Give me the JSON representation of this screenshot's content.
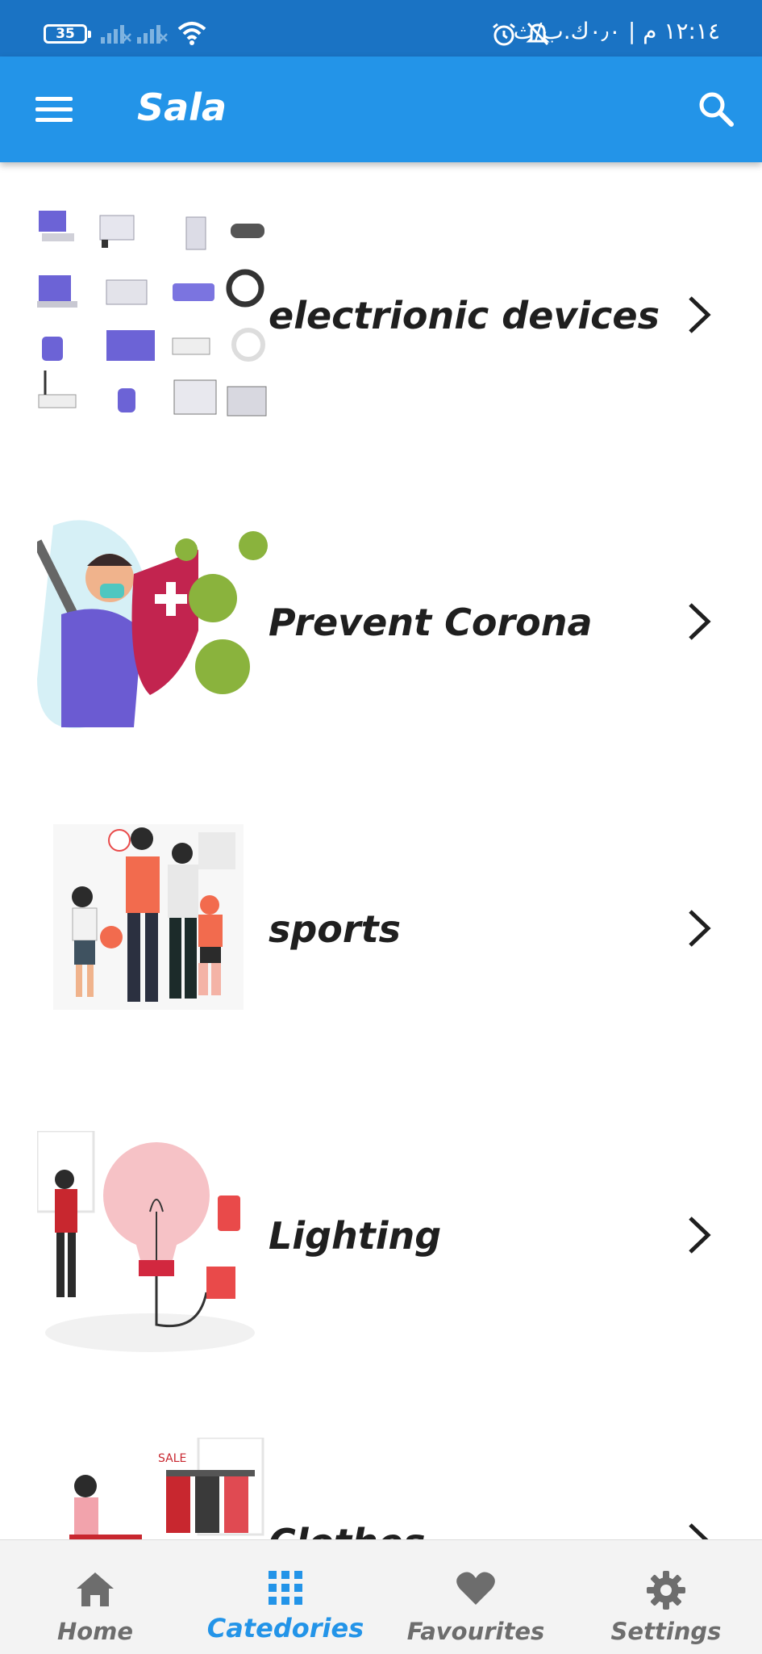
{
  "status_bar": {
    "battery_level": "35",
    "time_text": "١٢:١٤ م | ٠٫٠ك.ب/ث",
    "icons": [
      "battery-icon",
      "signal-icon",
      "signal-icon",
      "wifi-icon",
      "alarm-icon",
      "bell-off-icon"
    ]
  },
  "app_bar": {
    "title": "Sala",
    "menu_icon": "menu-icon",
    "search_icon": "search-icon",
    "color": "#2394e8"
  },
  "categories": [
    {
      "label": "electrionic devices",
      "icon": "chevron-right-icon",
      "image": "electronic-devices-illustration"
    },
    {
      "label": "Prevent Corona",
      "icon": "chevron-right-icon",
      "image": "prevent-corona-illustration"
    },
    {
      "label": "sports",
      "icon": "chevron-right-icon",
      "image": "sports-illustration"
    },
    {
      "label": "Lighting",
      "icon": "chevron-right-icon",
      "image": "lighting-illustration"
    },
    {
      "label": "Clothes",
      "icon": "chevron-right-icon",
      "image": "clothes-illustration"
    }
  ],
  "bottom_nav": {
    "items": [
      {
        "label": "Home",
        "icon": "home-icon"
      },
      {
        "label": "Catedories",
        "icon": "grid-icon"
      },
      {
        "label": "Favourites",
        "icon": "heart-icon"
      },
      {
        "label": "Settings",
        "icon": "gear-icon"
      }
    ],
    "active_index": 1,
    "active_color": "#2394e8",
    "inactive_color": "#6d6d6d"
  }
}
